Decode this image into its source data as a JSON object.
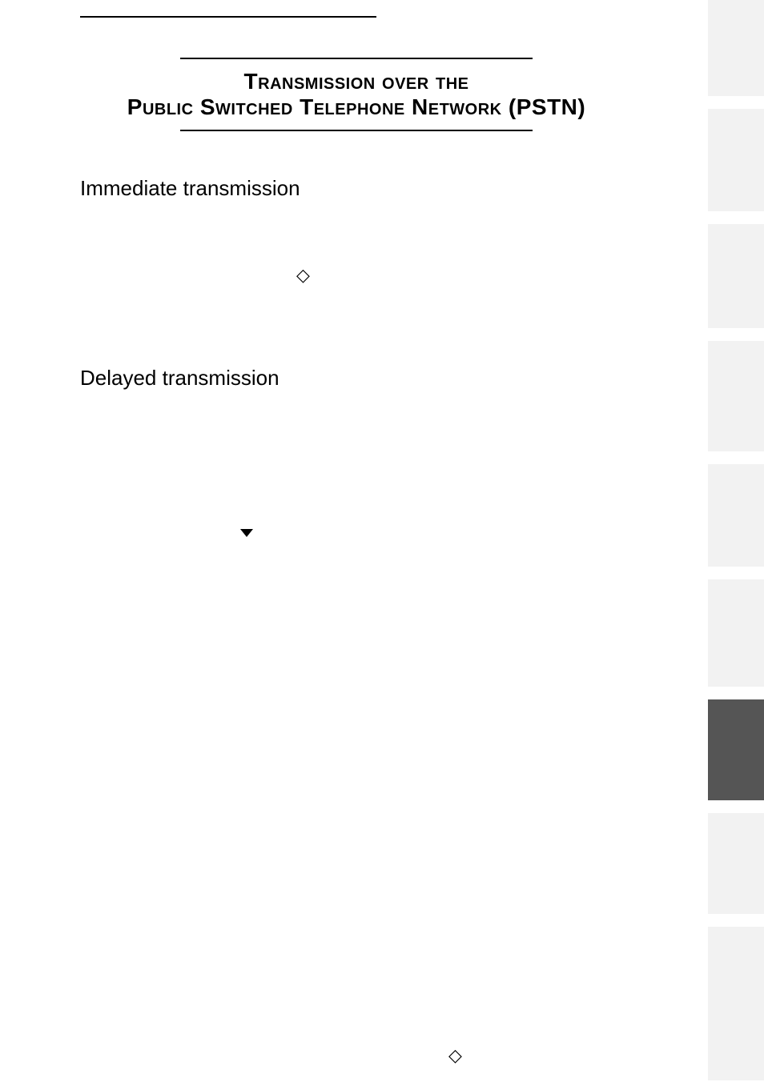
{
  "title": {
    "line1": "Transmission over the",
    "line2": "Public Switched Telephone Network (PSTN)"
  },
  "sections": {
    "immediate": "Immediate transmission",
    "delayed": "Delayed transmission"
  },
  "symbols": {
    "diamond1": "◇",
    "diamond2": "◇"
  },
  "tabs": {
    "heights": [
      120,
      16,
      128,
      16,
      130,
      16,
      138,
      16,
      128,
      16,
      134,
      16,
      126,
      16,
      126,
      16,
      192
    ],
    "darkIndex": 12
  }
}
